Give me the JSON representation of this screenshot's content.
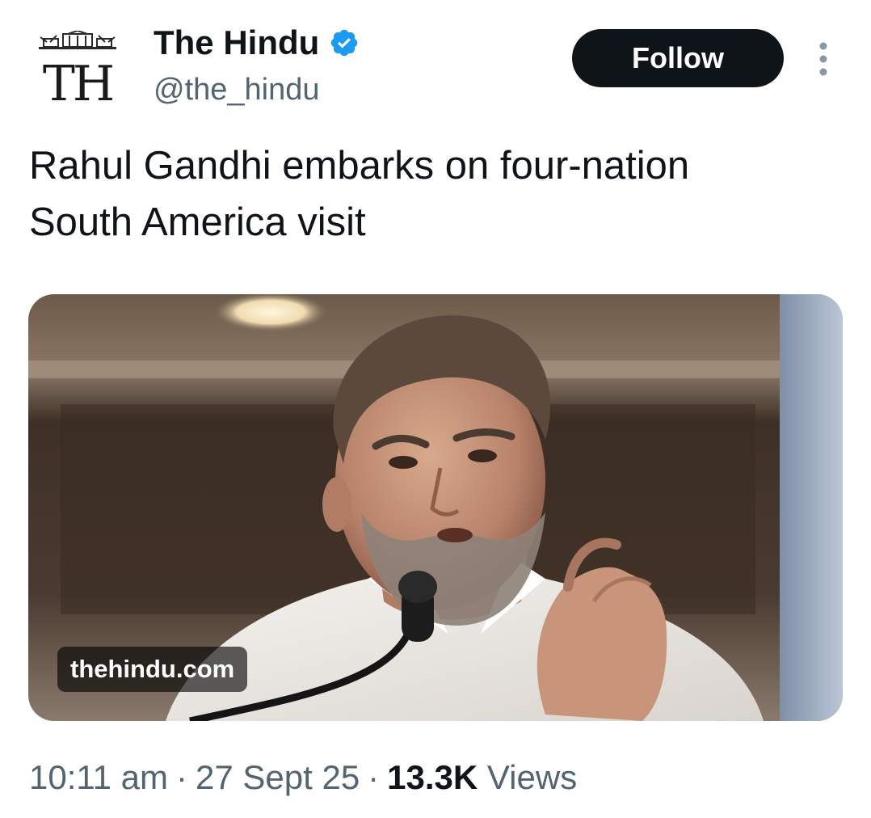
{
  "account": {
    "logo_text": "TH",
    "display_name": "The Hindu",
    "handle": "@the_hindu",
    "verified_color": "#1d9bf0"
  },
  "actions": {
    "follow_label": "Follow",
    "more_icon": "more-vertical-icon"
  },
  "tweet": {
    "text": "Rahul Gandhi embarks on four-nation\nSouth America visit"
  },
  "media": {
    "domain": "thehindu.com"
  },
  "meta": {
    "time": "10:11 am",
    "separator": "·",
    "date": "27 Sept 25",
    "views_count": "13.3K",
    "views_label": "Views"
  },
  "colors": {
    "primary_text": "#0f1419",
    "secondary_text": "#536471",
    "button_bg": "#0f1419"
  }
}
